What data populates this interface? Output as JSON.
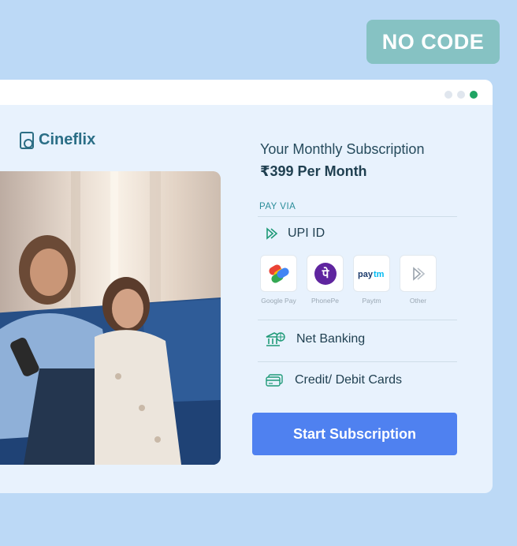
{
  "badge": {
    "text": "NO CODE"
  },
  "window": {
    "dots": [
      "inactive",
      "inactive",
      "active"
    ],
    "brand": {
      "name": "Cineflix",
      "icon": "tv-remote-icon"
    },
    "hero_image": {
      "icon": "family-watching-tv-photo"
    },
    "subscription": {
      "title": "Your Monthly Subscription",
      "price": "₹399 Per Month"
    },
    "payment": {
      "heading": "PAY VIA",
      "upi": {
        "label": "UPI ID",
        "icon": "upi-icon"
      },
      "apps": [
        {
          "label": "Google Pay",
          "icon": "google-pay-icon"
        },
        {
          "label": "PhonePe",
          "icon": "phonepe-icon"
        },
        {
          "label": "Paytm",
          "icon": "paytm-icon"
        },
        {
          "label": "Other",
          "icon": "upi-other-icon"
        }
      ],
      "net_banking": {
        "label": "Net Banking",
        "icon": "bank-icon"
      },
      "cards": {
        "label": "Credit/ Debit Cards",
        "icon": "card-icon"
      }
    },
    "cta": {
      "label": "Start Subscription"
    }
  },
  "colors": {
    "background": "#bcd9f6",
    "badge": "#86c2c3",
    "panel": "#e8f2fd",
    "accent_green": "#1fa463",
    "cta": "#4f81f0",
    "brand_text": "#2a6e86"
  }
}
